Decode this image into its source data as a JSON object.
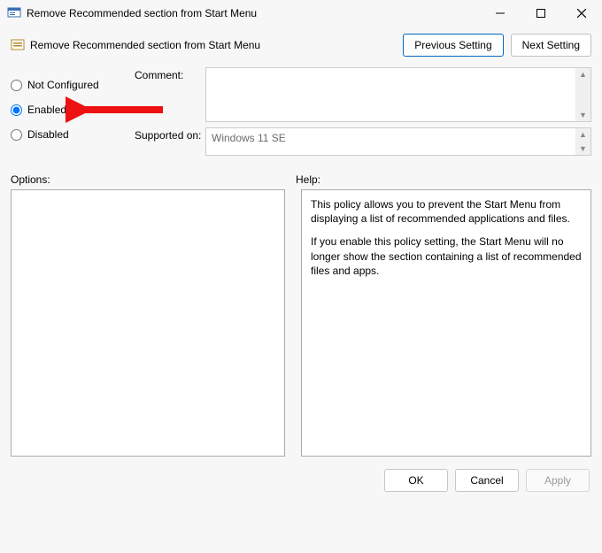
{
  "window": {
    "title": "Remove Recommended section from Start Menu"
  },
  "header": {
    "subtitle": "Remove Recommended section from Start Menu",
    "prev_label": "Previous Setting",
    "next_label": "Next Setting"
  },
  "radios": {
    "not_configured": "Not Configured",
    "enabled": "Enabled",
    "disabled": "Disabled",
    "selected": "enabled"
  },
  "fields": {
    "comment_label": "Comment:",
    "comment_value": "",
    "supported_label": "Supported on:",
    "supported_value": "Windows 11 SE"
  },
  "labels": {
    "options": "Options:",
    "help": "Help:"
  },
  "help": {
    "p1": "This policy allows you to prevent the Start Menu from displaying a list of recommended applications and files.",
    "p2": "If you enable this policy setting, the Start Menu will no longer show the section containing a list of recommended files and apps."
  },
  "footer": {
    "ok": "OK",
    "cancel": "Cancel",
    "apply": "Apply"
  }
}
